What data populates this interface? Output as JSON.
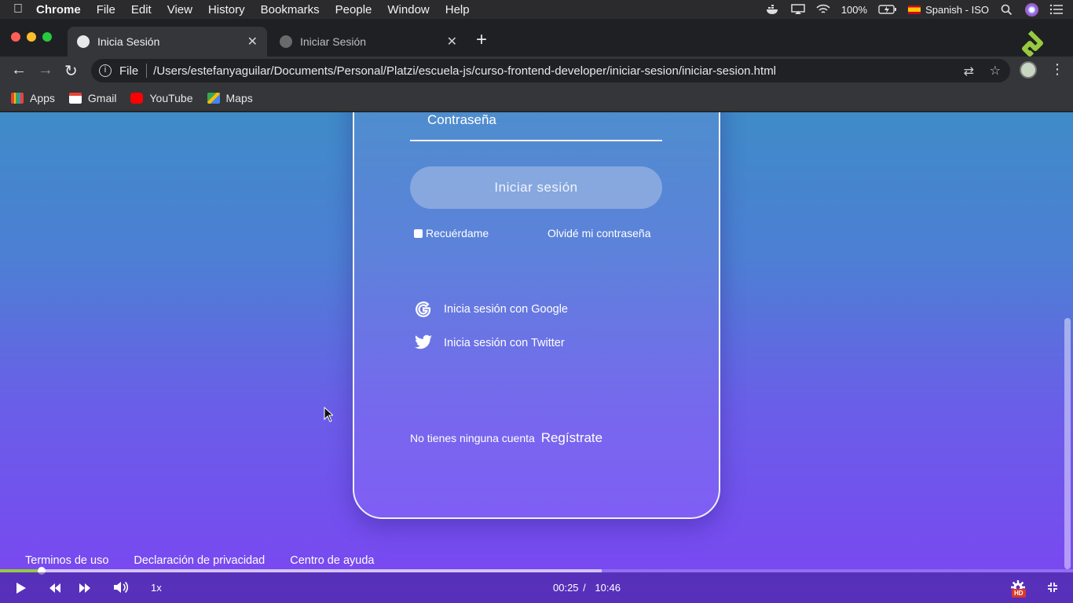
{
  "menubar": {
    "app": "Chrome",
    "items": [
      "File",
      "Edit",
      "View",
      "History",
      "Bookmarks",
      "People",
      "Window",
      "Help"
    ],
    "battery": "100%",
    "input_source": "Spanish - ISO"
  },
  "tabs": [
    {
      "title": "Inicia Sesión",
      "active": true
    },
    {
      "title": "Iniciar Sesión",
      "active": false
    }
  ],
  "address": {
    "scheme": "File",
    "url": "/Users/estefanyaguilar/Documents/Personal/Platzi/escuela-js/curso-frontend-developer/iniciar-sesion/iniciar-sesion.html"
  },
  "bookmarks": [
    {
      "label": "Apps",
      "icon": "apps-grid-icon"
    },
    {
      "label": "Gmail",
      "icon": "gmail-icon"
    },
    {
      "label": "YouTube",
      "icon": "youtube-icon"
    },
    {
      "label": "Maps",
      "icon": "maps-icon"
    }
  ],
  "login": {
    "password_label": "Contraseña",
    "submit_label": "Iniciar sesión",
    "remember_label": "Recuérdame",
    "forgot_label": "Olvidé mi contraseña",
    "google_label": "Inicia sesión con Google",
    "twitter_label": "Inicia sesión con Twitter",
    "signup_prompt": "No tienes ninguna cuenta",
    "signup_link": "Regístrate"
  },
  "footer": {
    "links": [
      "Terminos de uso",
      "Declaración de privacidad",
      "Centro de ayuda"
    ]
  },
  "player": {
    "current_time": "00:25",
    "separator": "/",
    "duration": "10:46",
    "speed": "1x",
    "quality_badge": "HD",
    "played_fraction": 0.039,
    "buffered_fraction": 0.561
  },
  "colors": {
    "progress_played": "#98ca3f",
    "traffic_red": "#fe5f57",
    "traffic_yellow": "#febc2e",
    "traffic_green": "#28c840"
  }
}
